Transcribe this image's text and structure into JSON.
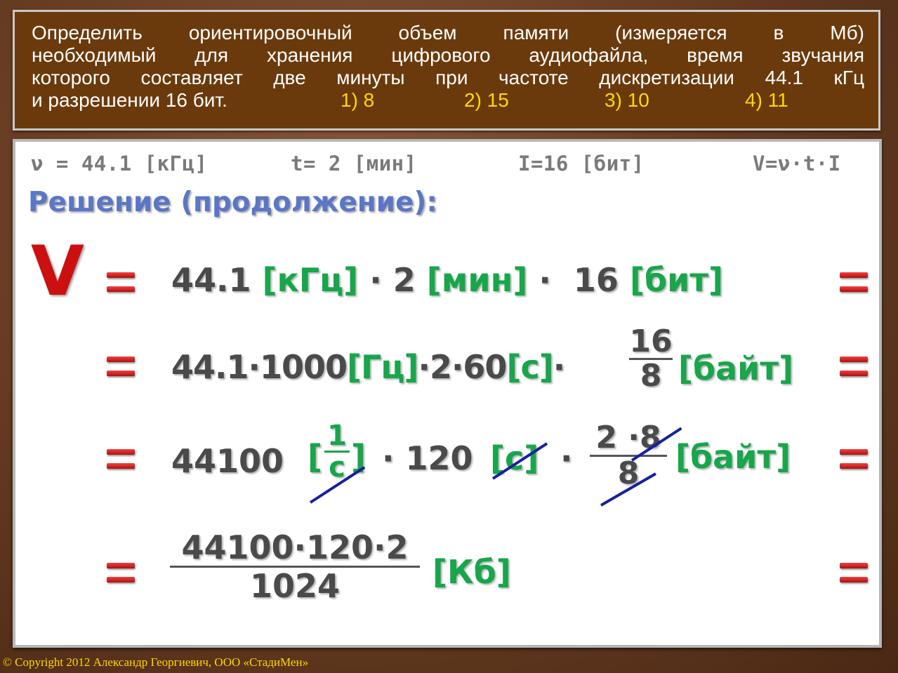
{
  "question": {
    "line1": "Определить ориентировочный объем памяти (измеряется в Мб)",
    "line2": "необходимый для хранения цифрового аудиофайла, время звучания",
    "line3": "которого составляет две минуты при частоте дискретизации 44.1 кГц",
    "line4": "и разрешении 16 бит.",
    "options": [
      "1) 8",
      "2) 15",
      "3) 10",
      "4) 11"
    ]
  },
  "given": {
    "nu": "ν = 44.1 [кГц]",
    "t": "t= 2  [мин]",
    "i": "I=16 [бит]",
    "formula": "V=ν·t·I"
  },
  "heading": "Решение (продолжение):",
  "big_v": "V",
  "row1": {
    "a": "44.1",
    "b": "[кГц]",
    "c": "· 2",
    "d": "[мин]",
    "e": "·  16",
    "f": "[бит]"
  },
  "row2": {
    "a": "44.1·1000",
    "b": "[Гц]",
    "c": "·2·60",
    "d": "[с]",
    "e": "·",
    "num": "16",
    "den": "8",
    "f": "[байт]"
  },
  "row3": {
    "a": "44100",
    "open": "[",
    "num": "1",
    "den": "с",
    "close": "]",
    "c": "· 120",
    "d": "[с]",
    "e": "·",
    "num2": "2 ·8",
    "den2": "8",
    "f": "[байт]"
  },
  "row4": {
    "num": "44100·120·2",
    "den": "1024",
    "f": "[Кб]"
  },
  "copyright": "© Copyright 2012 Александр Георгиевич, ООО «СтадиМен»",
  "colors": {
    "background": "#6b3f24",
    "question_bg": "#6b3a0c",
    "option": "#ffd800",
    "unit": "#17a64a",
    "equals": "#cc1010",
    "strike": "#15219e",
    "heading": "#5b76c6"
  }
}
